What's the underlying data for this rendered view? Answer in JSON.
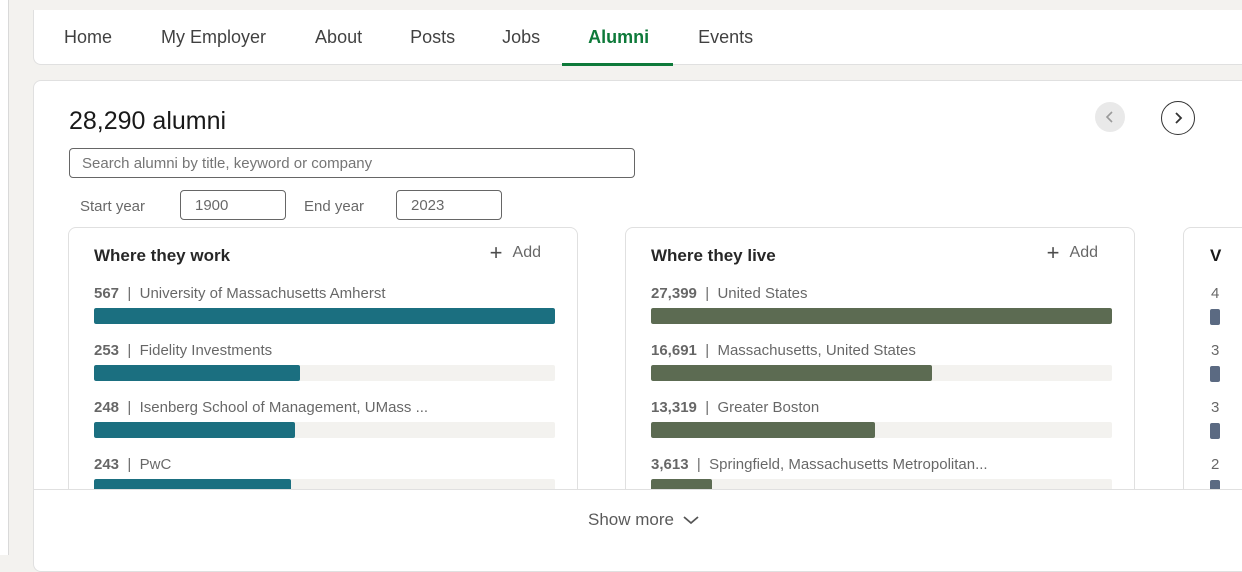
{
  "nav": {
    "tabs": [
      {
        "label": "Home"
      },
      {
        "label": "My Employer"
      },
      {
        "label": "About"
      },
      {
        "label": "Posts"
      },
      {
        "label": "Jobs"
      },
      {
        "label": "Alumni",
        "active": true
      },
      {
        "label": "Events"
      }
    ]
  },
  "alumni": {
    "count_label": "28,290 alumni",
    "search_placeholder": "Search alumni by title, keyword or company",
    "start_year_label": "Start year",
    "start_year_value": "1900",
    "end_year_label": "End year",
    "end_year_value": "2023"
  },
  "colors": {
    "accent": "#0e7a3a",
    "work_bar": "#1b6f80",
    "live_bar": "#5c6b52",
    "third_bar": "#5b6a82"
  },
  "panels": {
    "work": {
      "title": "Where they work",
      "add_label": "Add",
      "items": [
        {
          "count": "567",
          "name": "University of Massachusetts Amherst",
          "fraction": 1.0
        },
        {
          "count": "253",
          "name": "Fidelity Investments",
          "fraction": 0.446
        },
        {
          "count": "248",
          "name": "Isenberg School of Management, UMass ...",
          "fraction": 0.437
        },
        {
          "count": "243",
          "name": "PwC",
          "fraction": 0.428
        }
      ]
    },
    "live": {
      "title": "Where they live",
      "add_label": "Add",
      "items": [
        {
          "count": "27,399",
          "name": "United States",
          "fraction": 1.0
        },
        {
          "count": "16,691",
          "name": "Massachusetts, United States",
          "fraction": 0.609
        },
        {
          "count": "13,319",
          "name": "Greater Boston",
          "fraction": 0.486
        },
        {
          "count": "3,613",
          "name": "Springfield, Massachusetts Metropolitan...",
          "fraction": 0.132
        }
      ]
    },
    "third": {
      "title": "V",
      "counts": [
        "4",
        "3",
        "3",
        "2"
      ]
    }
  },
  "show_more_label": "Show more"
}
